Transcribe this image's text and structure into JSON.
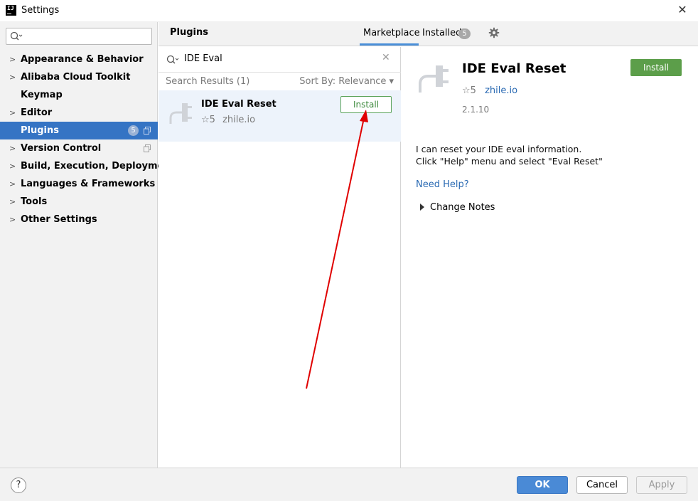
{
  "window": {
    "title": "Settings",
    "close_glyph": "✕"
  },
  "sidebar": {
    "search_placeholder": "",
    "items": [
      {
        "label": "Appearance & Behavior",
        "expandable": true
      },
      {
        "label": "Alibaba Cloud Toolkit",
        "expandable": true
      },
      {
        "label": "Keymap",
        "expandable": false
      },
      {
        "label": "Editor",
        "expandable": true
      },
      {
        "label": "Plugins",
        "expandable": false,
        "active": true,
        "badge": "5"
      },
      {
        "label": "Version Control",
        "expandable": true
      },
      {
        "label": "Build, Execution, Deployment",
        "expandable": true
      },
      {
        "label": "Languages & Frameworks",
        "expandable": true
      },
      {
        "label": "Tools",
        "expandable": true
      },
      {
        "label": "Other Settings",
        "expandable": true
      }
    ]
  },
  "header": {
    "title": "Plugins",
    "tabs": {
      "marketplace": "Marketplace",
      "installed": "Installed",
      "installed_badge": "5"
    }
  },
  "search": {
    "query": "IDE Eval",
    "results_label": "Search Results (1)",
    "sort_label": "Sort By: Relevance ▾"
  },
  "plugin_card": {
    "name": "IDE Eval Reset",
    "rating": "☆5",
    "vendor": "zhile.io",
    "install_label": "Install"
  },
  "detail": {
    "name": "IDE Eval Reset",
    "rating": "☆5",
    "vendor": "zhile.io",
    "version": "2.1.10",
    "install_label": "Install",
    "description_line1": "I can reset your IDE eval information.",
    "description_line2": "Click \"Help\" menu and select \"Eval Reset\"",
    "help_link": "Need Help?",
    "change_notes": "Change Notes"
  },
  "footer": {
    "help": "?",
    "ok": "OK",
    "cancel": "Cancel",
    "apply": "Apply"
  },
  "colors": {
    "accent": "#3574c4",
    "install_green": "#5c9e4a",
    "link": "#2a6ab3",
    "annotation_arrow": "#e00000"
  },
  "icons": [
    "intellij-logo-icon",
    "search-icon",
    "chevron-right-icon",
    "copy-icon",
    "gear-icon",
    "plug-icon",
    "star-icon",
    "clear-icon",
    "help-icon"
  ]
}
